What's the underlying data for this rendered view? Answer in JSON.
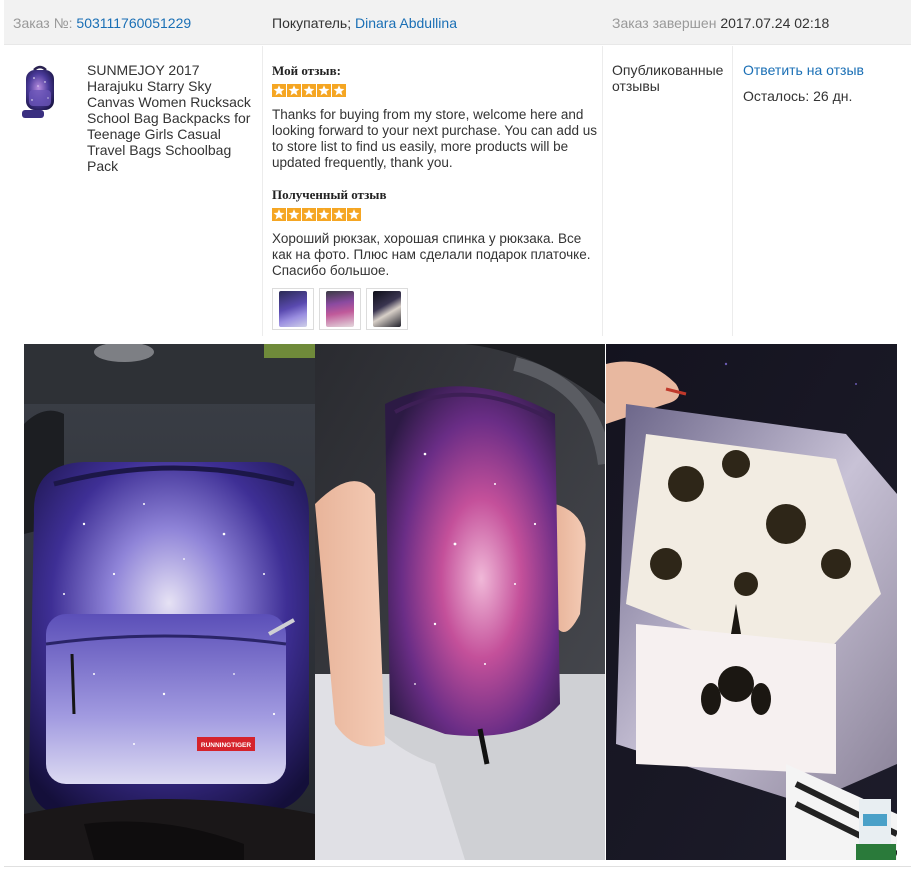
{
  "header": {
    "order_label": "Заказ №:",
    "order_number": "503111760051229",
    "buyer_label": "Покупатель;",
    "buyer_name": "Dinara Abdullina",
    "completed_label": "Заказ завершен",
    "completed_date": "2017.07.24 02:18"
  },
  "product": {
    "title": "SUNMEJOY 2017 Harajuku Starry Sky Canvas Women Rucksack School Bag Backpacks for Teenage Girls Casual Travel Bags Schoolbag Pack",
    "thumbnail_icon": "backpack-image"
  },
  "my_review": {
    "label": "Мой отзыв:",
    "stars": 5,
    "text": "Thanks for buying from my store, welcome here and looking forward to your next purchase. You can add us to store list to find us easily, more products will be updated frequently, thank you."
  },
  "received_review": {
    "label": "Полученный отзыв",
    "stars": 5,
    "text": "Хороший рюкзак, хорошая спинка у рюкзака. Все как на фото. Плюс нам сделали подарок платочке. Спасибо большое.",
    "thumbnails": [
      "backpack-photo",
      "pencil-case-photo",
      "scarf-photo"
    ]
  },
  "status": {
    "text": "Опубликованные отзывы"
  },
  "actions": {
    "reply_label": "Ответить на отзыв",
    "remaining_label": "Осталось: 26 дн."
  },
  "photos": {
    "items": [
      "backpack-photo",
      "pencil-case-photo",
      "scarf-photo"
    ],
    "brand_tag": "RUNNINGTIGER"
  },
  "colors": {
    "link": "#1a6fb5",
    "star": "#f5a623",
    "header_bg": "#f2f2f2"
  }
}
